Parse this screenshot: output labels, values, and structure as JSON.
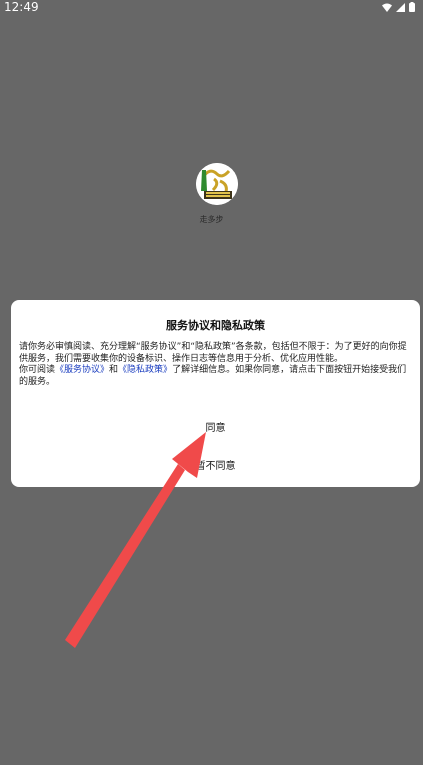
{
  "status_bar": {
    "time": "12:49"
  },
  "app": {
    "name": "走多步"
  },
  "dialog": {
    "title": "服务协议和隐私政策",
    "paragraph1": "请你务必审慎阅读、充分理解“服务协议”和“隐私政策”各条款，包括但不限于：为了更好的向你提供服务，我们需要收集你的设备标识、操作日志等信息用于分析、优化应用性能。",
    "p2_prefix": "你可阅读",
    "service_link": "《服务协议》",
    "p2_and": "和",
    "privacy_link": "《隐私政策》",
    "p2_suffix": "了解详细信息。如果你同意，请点击下面按钮开始接受我们的服务。",
    "agree": "同意",
    "disagree": "暂不同意"
  },
  "colors": {
    "overlay": "#676767",
    "link": "#1a3dbf",
    "arrow": "#f04a4a"
  },
  "icons": [
    "wifi-icon",
    "signal-icon",
    "battery-icon"
  ]
}
